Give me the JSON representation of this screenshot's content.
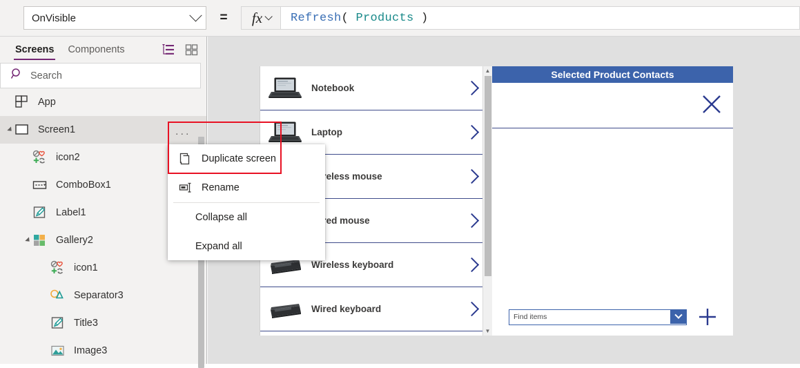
{
  "formula_bar": {
    "property": "OnVisible",
    "equals": "=",
    "fx_label": "fx",
    "formula_parts": [
      {
        "text": "Refresh",
        "color": "#3a6fb5"
      },
      {
        "text": "( ",
        "color": "#201f1e"
      },
      {
        "text": "Products",
        "color": "#1a8a8a"
      },
      {
        "text": " )",
        "color": "#201f1e"
      }
    ],
    "formula_plain": "Refresh( Products )"
  },
  "tree_pane": {
    "tabs": [
      {
        "label": "Screens",
        "active": true
      },
      {
        "label": "Components",
        "active": false
      }
    ],
    "view_icons": [
      {
        "name": "tree-view-icon"
      },
      {
        "name": "thumbnail-view-icon"
      }
    ],
    "search": {
      "placeholder": "Search",
      "value": "",
      "icon": "search-icon"
    },
    "items": [
      {
        "label": "App",
        "icon": "app-icon",
        "indent": 0,
        "twisty": false,
        "selected": false
      },
      {
        "label": "Screen1",
        "icon": "screen-icon",
        "indent": 0,
        "twisty": true,
        "selected": true
      },
      {
        "label": "icon2",
        "icon": "icon-control-icon",
        "indent": 1,
        "twisty": false,
        "selected": false
      },
      {
        "label": "ComboBox1",
        "icon": "combobox-icon",
        "indent": 1,
        "twisty": false,
        "selected": false
      },
      {
        "label": "Label1",
        "icon": "label-icon",
        "indent": 1,
        "twisty": false,
        "selected": false
      },
      {
        "label": "Gallery2",
        "icon": "gallery-icon",
        "indent": 1,
        "twisty": true,
        "selected": false
      },
      {
        "label": "icon1",
        "icon": "icon-control-icon",
        "indent": 2,
        "twisty": false,
        "selected": false
      },
      {
        "label": "Separator3",
        "icon": "shapes-icon",
        "indent": 2,
        "twisty": false,
        "selected": false
      },
      {
        "label": "Title3",
        "icon": "label-icon",
        "indent": 2,
        "twisty": false,
        "selected": false
      },
      {
        "label": "Image3",
        "icon": "image-icon",
        "indent": 2,
        "twisty": false,
        "selected": false
      }
    ]
  },
  "context_menu": {
    "overflow_label": "···",
    "items": [
      {
        "label": "Duplicate screen",
        "icon": "duplicate-icon",
        "highlighted": true
      },
      {
        "label": "Rename",
        "icon": "rename-icon",
        "highlighted": false
      },
      {
        "label": "Collapse all",
        "icon": null,
        "highlighted": false
      },
      {
        "label": "Expand all",
        "icon": null,
        "highlighted": false
      }
    ],
    "highlight_color": "#e81123"
  },
  "canvas": {
    "gallery": {
      "items": [
        {
          "label": "Notebook",
          "thumb": "laptop-photo"
        },
        {
          "label": "Laptop",
          "thumb": "laptop-photo"
        },
        {
          "label": "Wireless mouse",
          "thumb": "mouse-photo"
        },
        {
          "label": "Wired mouse",
          "thumb": "mouse-photo"
        },
        {
          "label": "Wireless keyboard",
          "thumb": "keyboard-photo"
        },
        {
          "label": "Wired keyboard",
          "thumb": "keyboard-photo"
        }
      ],
      "chevron_icon": "chevron-right-icon",
      "chevron_color": "#2b3a8f"
    },
    "form_panel": {
      "title": "Selected Product Contacts",
      "title_bg": "#3c63ab",
      "close_icon": "close-x-icon",
      "combobox": {
        "placeholder": "Find items",
        "value": "",
        "dropdown_icon": "chevron-down-icon"
      },
      "add_icon": "plus-icon"
    }
  }
}
